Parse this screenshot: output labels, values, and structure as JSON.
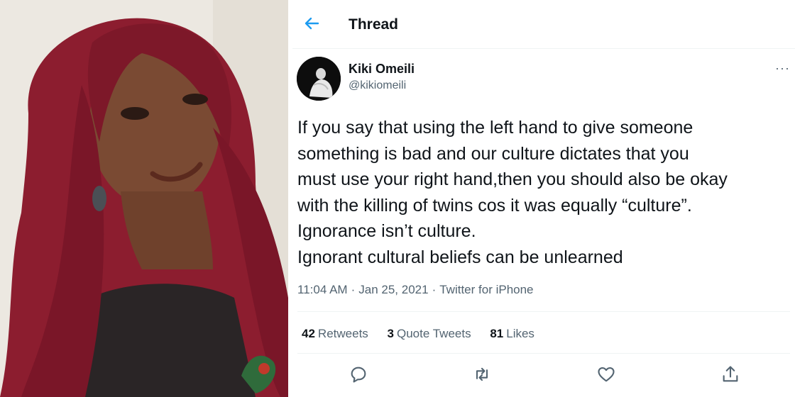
{
  "header": {
    "title": "Thread"
  },
  "author": {
    "name": "Kiki Omeili",
    "handle": "@kikiomeili"
  },
  "tweet": {
    "lines": [
      "If you say that using the left hand to give someone",
      "something is bad and our culture dictates that you",
      "must use your right hand,then you should also be okay",
      "with the killing of twins cos it was equally “culture”.",
      "Ignorance isn’t culture.",
      "Ignorant cultural beliefs can be unlearned"
    ],
    "time": "11:04 AM",
    "date": "Jan 25, 2021",
    "source": "Twitter for iPhone",
    "meta_sep": "·"
  },
  "stats": {
    "retweets": {
      "count": "42",
      "label": "Retweets"
    },
    "quotes": {
      "count": "3",
      "label": "Quote Tweets"
    },
    "likes": {
      "count": "81",
      "label": "Likes"
    }
  },
  "more_label": "···",
  "icons": {
    "back": "arrow-left-icon",
    "reply": "reply-icon",
    "retweet": "retweet-icon",
    "like": "heart-icon",
    "share": "share-icon"
  },
  "colors": {
    "accent": "#1d9bf0",
    "text": "#0f1419",
    "muted": "#536471",
    "hair": "#8c1d2f"
  }
}
